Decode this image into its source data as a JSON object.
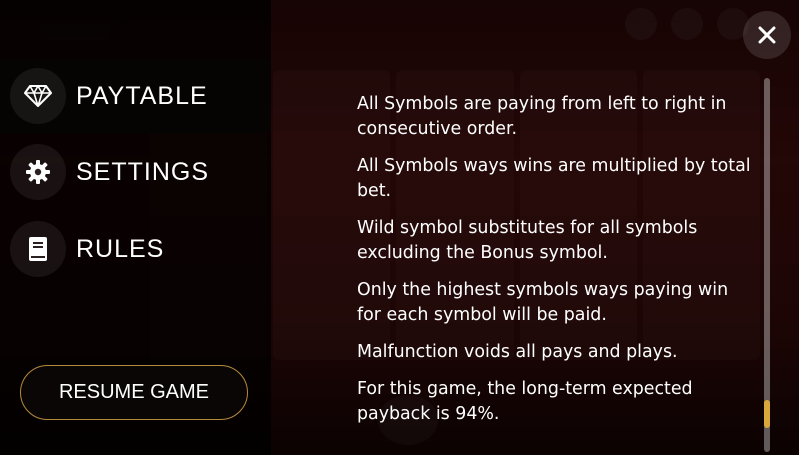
{
  "menu": {
    "items": [
      {
        "label": "PAYTABLE",
        "icon": "diamond-icon"
      },
      {
        "label": "SETTINGS",
        "icon": "gear-icon"
      },
      {
        "label": "RULES",
        "icon": "book-icon"
      }
    ],
    "active": "PAYTABLE",
    "resume_label": "RESUME GAME"
  },
  "close": {
    "icon": "close-icon",
    "glyph": "✕"
  },
  "rules": {
    "paragraphs": [
      "All Symbols are paying from left to right in consecutive order.",
      "All Symbols ways wins are multiplied by total bet.",
      "Wild symbol substitutes for all symbols excluding the Bonus symbol.",
      "Only the highest symbols ways paying win for each symbol will be paid.",
      "Malfunction voids all pays and plays.",
      "For this game, the long-term expected payback is 94%."
    ]
  },
  "scroll": {
    "position_fraction": 0.93
  },
  "colors": {
    "accent": "#d8a93a",
    "button_border": "#b58a3c",
    "background": "#3a0a0a"
  }
}
